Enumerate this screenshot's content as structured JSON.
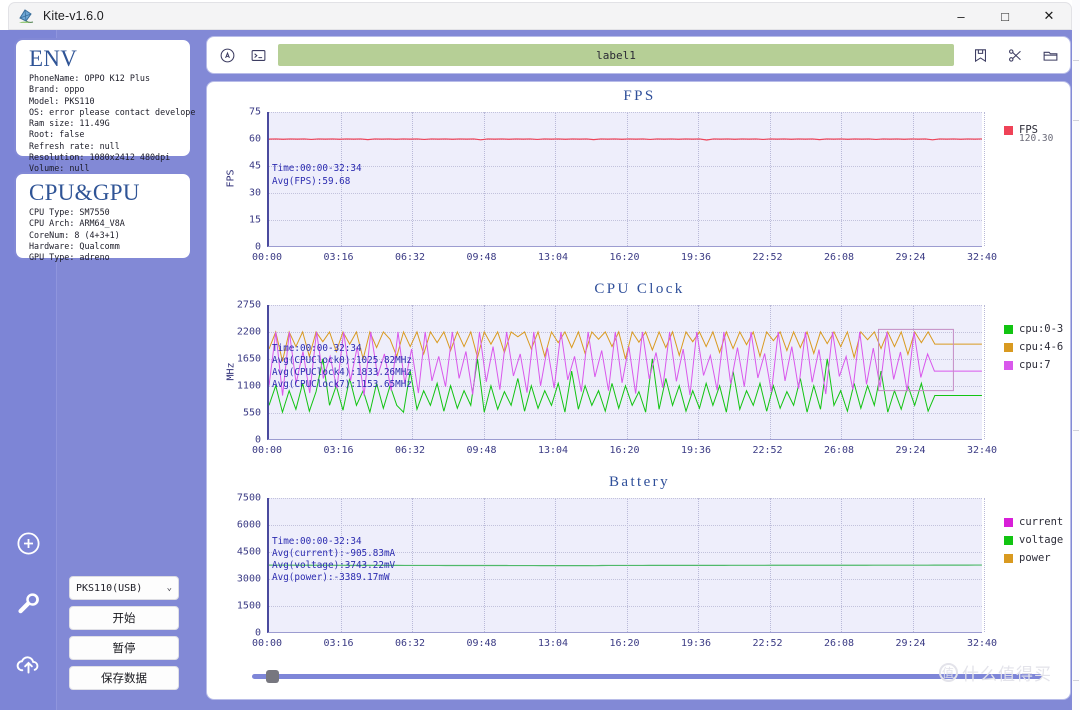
{
  "window": {
    "title": "Kite-v1.6.0",
    "icon": "kite-icon",
    "minimize": "–",
    "maximize": "□",
    "close": "✕"
  },
  "env_card": {
    "title": "ENV",
    "lines": [
      "PhoneName: OPPO K12 Plus",
      "Brand: oppo",
      "Model: PKS110",
      "OS: error please contact develope",
      "Ram size: 11.49G",
      "Root: false",
      "Refresh rate: null",
      "Resolution: 1080x2412 480dpi",
      "Volume: null"
    ]
  },
  "cpu_card": {
    "title": "CPU&GPU",
    "lines": [
      "CPU Type: SM7550",
      "CPU Arch: ARM64_V8A",
      "CoreNum: 8 (4+3+1)",
      "Hardware: Qualcomm",
      "GPU Type: adreno"
    ]
  },
  "rail": {
    "items": [
      {
        "icon": "plus-circle-icon"
      },
      {
        "icon": "wrench-icon"
      },
      {
        "icon": "cloud-upload-icon"
      }
    ]
  },
  "controls": {
    "device_value": "PKS110(USB)",
    "device_chevron": "⌄",
    "start_label": "开始",
    "pause_label": "暂停",
    "save_label": "保存数据"
  },
  "toolbar": {
    "left_icons": [
      {
        "name": "android-circle-icon"
      },
      {
        "name": "terminal-icon"
      }
    ],
    "label_value": "label1",
    "right_icons": [
      {
        "name": "bookmark-icon"
      },
      {
        "name": "scissors-icon"
      },
      {
        "name": "folder-open-icon"
      }
    ]
  },
  "slider": {
    "value": 0
  },
  "watermark": {
    "mark": "值",
    "text": "什么值得买"
  },
  "chart_data": [
    {
      "type": "line",
      "title": "FPS",
      "ylabel": "FPS",
      "xlabel": "",
      "ylim": [
        0,
        75
      ],
      "yticks": [
        0,
        15,
        30,
        45,
        60,
        75
      ],
      "x_categories": [
        "00:00",
        "03:16",
        "06:32",
        "09:48",
        "13:04",
        "16:20",
        "19:36",
        "22:52",
        "26:08",
        "29:24",
        "32:40"
      ],
      "grid": true,
      "legend_position": "right",
      "annotations": [
        "Time:00:00-32:34",
        "Avg(FPS):59.68"
      ],
      "legend": [
        {
          "name": "FPS",
          "color": "#ef4257",
          "sub": "120.30"
        }
      ],
      "series": [
        {
          "name": "FPS",
          "color": "#ef4257",
          "values": [
            59.9,
            60,
            59.8,
            60,
            59.9,
            60,
            59.7,
            60,
            59.9,
            60,
            59.8,
            60,
            59.9,
            60,
            59.6,
            60,
            59.9,
            60,
            59.8,
            60,
            59.9,
            60,
            59.7,
            60,
            59.9,
            60,
            59.8,
            60,
            59.9,
            60,
            59.5,
            60,
            59.9,
            60,
            59.8,
            60,
            59.9,
            60,
            59.7,
            60,
            59.9,
            60,
            59.8,
            60,
            59.9,
            60,
            59.6,
            60,
            59.9,
            60,
            59.8,
            60,
            59.9,
            60,
            59.7,
            60,
            59.9,
            60,
            59.8,
            60,
            59.9,
            60,
            59.4,
            60,
            59.9,
            60,
            59.8,
            60,
            59.9,
            60,
            59.7,
            60,
            59.9,
            60,
            59.8,
            60,
            59.9,
            60,
            59.6,
            60,
            59.9,
            60,
            59.8,
            60,
            59.9,
            60,
            59.7,
            60,
            59.9,
            60,
            59.8,
            60,
            59.9,
            60,
            59.5,
            60,
            59.9,
            60,
            59.8,
            60,
            59.9,
            60
          ]
        }
      ]
    },
    {
      "type": "line",
      "title": "CPU Clock",
      "ylabel": "MHz",
      "xlabel": "",
      "ylim": [
        0,
        2750
      ],
      "yticks": [
        0,
        550,
        1100,
        1650,
        2200,
        2750
      ],
      "x_categories": [
        "00:00",
        "03:16",
        "06:32",
        "09:48",
        "13:04",
        "16:20",
        "19:36",
        "22:52",
        "26:08",
        "29:24",
        "32:40"
      ],
      "grid": true,
      "legend_position": "right",
      "annotations": [
        "Time:00:00-32:34",
        "Avg(CPUClock0):1025.82MHz",
        "Avg(CPUClock4):1833.26MHz",
        "Avg(CPUClock7):1153.65MHz"
      ],
      "legend": [
        {
          "name": "cpu:0-3",
          "color": "#12c412"
        },
        {
          "name": "cpu:4-6",
          "color": "#d99a20"
        },
        {
          "name": "cpu:7",
          "color": "#d958ec"
        }
      ],
      "series": [
        {
          "name": "cpu:0-3",
          "color": "#12c412",
          "values": [
            700,
            1100,
            560,
            1000,
            620,
            1150,
            580,
            980,
            1650,
            700,
            1100,
            600,
            1250,
            700,
            1000,
            560,
            1150,
            640,
            1100,
            700,
            560,
            1400,
            620,
            1000,
            700,
            1150,
            580,
            1100,
            640,
            1000,
            700,
            1650,
            560,
            1100,
            620,
            980,
            700,
            1250,
            580,
            1100,
            640,
            1000,
            700,
            1150,
            560,
            1400,
            620,
            1100,
            700,
            1000,
            580,
            1150,
            640,
            1100,
            700,
            980,
            560,
            1650,
            620,
            1250,
            700,
            1100,
            580,
            1000,
            640,
            1150,
            700,
            1100,
            560,
            1400,
            620,
            1000,
            700,
            1150,
            580,
            1100,
            640,
            980,
            700,
            1250,
            560,
            1100,
            620,
            1650,
            700,
            1000,
            580,
            1150,
            640,
            1100,
            700,
            1400,
            560,
            1000,
            620,
            1100,
            700,
            1150,
            580,
            900,
            900,
            900,
            900,
            900,
            900,
            900,
            900
          ]
        },
        {
          "name": "cpu:4-6",
          "color": "#d99a20",
          "values": [
            1850,
            2200,
            1600,
            2200,
            1900,
            2200,
            1700,
            2200,
            2000,
            2200,
            1800,
            2200,
            1950,
            2200,
            1650,
            2200,
            1880,
            2200,
            2050,
            1700,
            2200,
            1900,
            2200,
            1750,
            2200,
            1980,
            2200,
            1820,
            2200,
            1900,
            2200,
            1680,
            2200,
            1950,
            2200,
            1780,
            2200,
            2100,
            2200,
            1850,
            2200,
            1700,
            2200,
            1980,
            2200,
            1880,
            2200,
            1760,
            2200,
            2050,
            2200,
            1900,
            2200,
            1650,
            2200,
            1990,
            2200,
            1830,
            2200,
            1880,
            2200,
            1720,
            2200,
            2000,
            2200,
            1900,
            2200,
            1780,
            2200,
            1860,
            2200,
            1940,
            2200,
            1700,
            2200,
            2020,
            2200,
            1820,
            2200,
            1880,
            2200,
            1760,
            2200,
            1960,
            2200,
            1900,
            2200,
            1680,
            2200,
            2040,
            2200,
            1860,
            2200,
            1900,
            2200,
            1740,
            2200,
            1980,
            2200,
            1950,
            1950,
            1950,
            1950,
            1950,
            1950,
            1950,
            1950
          ]
        },
        {
          "name": "cpu:7",
          "color": "#d958ec",
          "values": [
            1100,
            2200,
            900,
            2200,
            1150,
            1800,
            950,
            2200,
            1250,
            1700,
            1050,
            2200,
            1200,
            1900,
            900,
            2200,
            1300,
            1750,
            1000,
            2200,
            1150,
            1850,
            950,
            2200,
            1200,
            1700,
            1080,
            2200,
            1250,
            1800,
            920,
            2200,
            1180,
            1900,
            1020,
            2200,
            1300,
            1750,
            960,
            2200,
            1100,
            1880,
            1050,
            2200,
            1220,
            1700,
            980,
            2200,
            1280,
            1820,
            1000,
            2200,
            1160,
            1900,
            940,
            2200,
            1240,
            1780,
            1060,
            2200,
            1190,
            1850,
            910,
            2200,
            1310,
            1720,
            1010,
            2200,
            1140,
            1880,
            1080,
            2200,
            1260,
            1760,
            970,
            2200,
            1200,
            1900,
            1040,
            2200,
            1170,
            1840,
            930,
            2200,
            1290,
            1700,
            1020,
            2200,
            1130,
            1870,
            1070,
            2200,
            1230,
            1790,
            990,
            2200,
            1270,
            1750,
            1400,
            1400,
            1400,
            1400,
            1400,
            1400,
            1400,
            1400
          ]
        }
      ]
    },
    {
      "type": "line",
      "title": "Battery",
      "ylabel": "",
      "xlabel": "",
      "ylim": [
        0,
        7500
      ],
      "yticks": [
        0,
        1500,
        3000,
        4500,
        6000,
        7500
      ],
      "x_categories": [
        "00:00",
        "03:16",
        "06:32",
        "09:48",
        "13:04",
        "16:20",
        "19:36",
        "22:52",
        "26:08",
        "29:24",
        "32:40"
      ],
      "grid": true,
      "legend_position": "right",
      "annotations": [
        "Time:00:00-32:34",
        "Avg(current):-905.83mA",
        "Avg(voltage):3743.22mV",
        "Avg(power):-3389.17mW"
      ],
      "legend": [
        {
          "name": "current",
          "color": "#d81fd8"
        },
        {
          "name": "voltage",
          "color": "#12c412"
        },
        {
          "name": "power",
          "color": "#d99a20"
        }
      ],
      "series": [
        {
          "name": "voltage",
          "color": "#4fb96a",
          "values": [
            3760,
            3758,
            3757,
            3756,
            3755,
            3754,
            3753,
            3752,
            3751,
            3750,
            3750,
            3749,
            3748,
            3748,
            3747,
            3747,
            3746,
            3746,
            3745,
            3745,
            3744,
            3744,
            3743,
            3743,
            3742,
            3742,
            3741,
            3741,
            3740,
            3740,
            3739,
            3739,
            3738,
            3738,
            3737,
            3737,
            3736,
            3736,
            3735,
            3735,
            3734,
            3734,
            3733,
            3733,
            3732,
            3732,
            3731,
            3731,
            3730,
            3740,
            3742,
            3743,
            3743,
            3744,
            3744,
            3744,
            3745,
            3745,
            3745,
            3746,
            3746,
            3746,
            3747,
            3747,
            3747,
            3748,
            3748,
            3748,
            3749,
            3749,
            3749,
            3750,
            3750,
            3750,
            3751,
            3751,
            3751,
            3752,
            3752,
            3752,
            3753,
            3753,
            3753,
            3754,
            3754,
            3754,
            3755,
            3755,
            3755,
            3756,
            3756,
            3756,
            3757,
            3757,
            3757,
            3758,
            3758,
            3758,
            3759,
            3759,
            3760,
            3760,
            3761,
            3761,
            3762,
            3762
          ]
        }
      ]
    }
  ]
}
